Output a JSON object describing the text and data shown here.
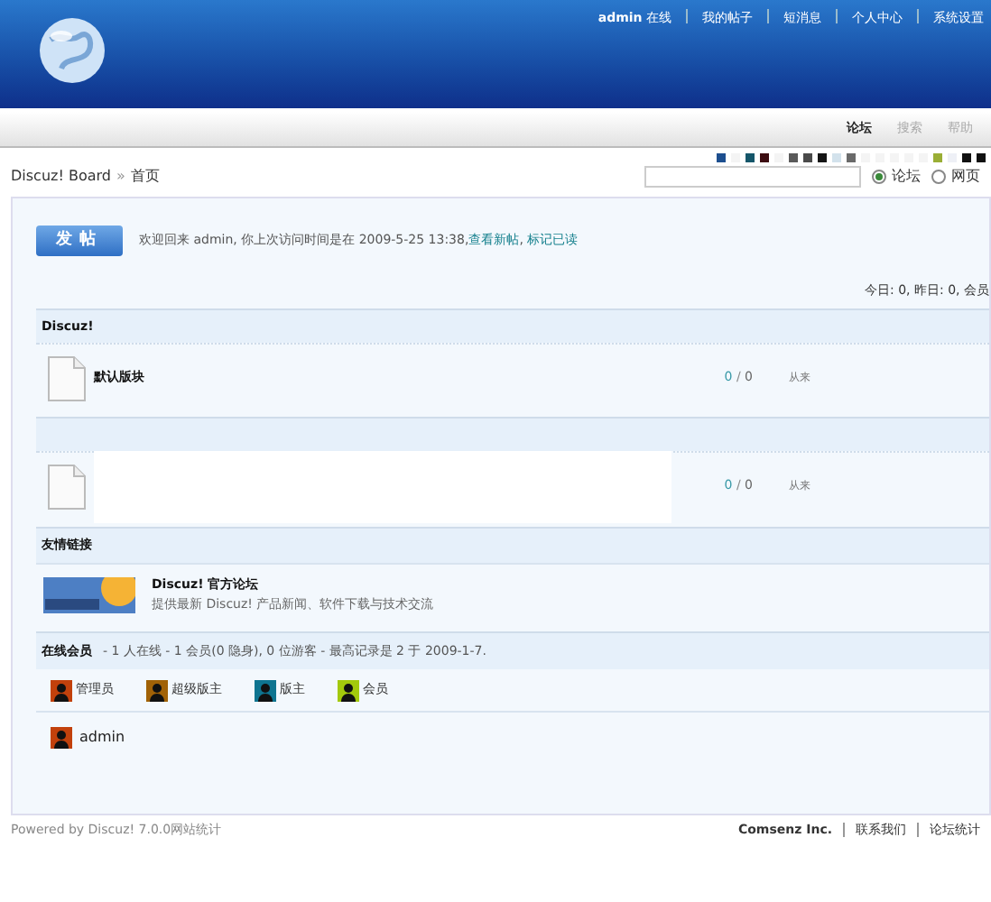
{
  "user_bar": {
    "user": "admin",
    "status": "在线",
    "links": [
      "我的帖子",
      "短消息",
      "个人中心",
      "系统设置"
    ]
  },
  "nav": [
    {
      "label": "论坛",
      "selected": true
    },
    {
      "label": "搜索",
      "selected": false
    },
    {
      "label": "帮助",
      "selected": false
    }
  ],
  "style_swatches": [
    {
      "color": "#1d4f8f"
    },
    {
      "color": "#f4f4f4"
    },
    {
      "color": "#15566a"
    },
    {
      "color": "#3d0d12"
    },
    {
      "color": "#f4f4f4"
    },
    {
      "color": "#5a5a5a"
    },
    {
      "color": "#4a4a4a"
    },
    {
      "color": "#151515"
    },
    {
      "color": "#d3e2ec"
    },
    {
      "color": "#6a6a6a"
    },
    {
      "color": "#f4f4f4"
    },
    {
      "color": "#f4f4f4"
    },
    {
      "color": "#f4f4f4"
    },
    {
      "color": "#f4f4f4"
    },
    {
      "color": "#f4f4f4"
    },
    {
      "color": "#9aae35"
    },
    {
      "color": "#eef0f6"
    },
    {
      "color": "#111111"
    },
    {
      "color": "#111111"
    }
  ],
  "breadcrumb": {
    "root": "Discuz! Board",
    "separator": "»",
    "current": "首页"
  },
  "search": {
    "scopes": [
      {
        "label": "论坛",
        "selected": true
      },
      {
        "label": "网页",
        "selected": false
      }
    ]
  },
  "post_button": "发帖",
  "welcome": {
    "text": "欢迎回来 admin, 你上次访问时间是在 2009-5-25 13:38,",
    "links": [
      "查看新帖",
      "标记已读"
    ],
    "link_separator": ","
  },
  "stats": "今日: 0, 昨日: 0, 会员",
  "categories": [
    {
      "title": "Discuz!",
      "forums": [
        {
          "name": "默认版块",
          "today": "0",
          "separator": "/",
          "total": "0",
          "last": "从来"
        }
      ]
    },
    {
      "forums": [
        {
          "today": "0",
          "separator": "/",
          "total": "0",
          "last": "从来"
        }
      ]
    }
  ],
  "friend_links": {
    "title": "友情链接",
    "items": [
      {
        "name": "Discuz! 官方论坛",
        "description": "提供最新 Discuz! 产品新闻、软件下载与技术交流"
      }
    ]
  },
  "online": {
    "title": "在线会员",
    "summary": "- 1 人在线 - 1 会员(0 隐身), 0 位游客 - 最高记录是 2 于 2009-1-7.",
    "groups": [
      {
        "label": "管理员",
        "color": "#c2410c"
      },
      {
        "label": "超级版主",
        "color": "#a16207"
      },
      {
        "label": "版主",
        "color": "#0e7490"
      },
      {
        "label": "会员",
        "color": "#a3c90c"
      }
    ],
    "members": [
      {
        "name": "admin",
        "color": "#c2410c"
      }
    ]
  },
  "footer": {
    "powered": "Powered by Discuz! 7.0.0网站统计",
    "company": "Comsenz Inc.",
    "links": [
      "联系我们",
      "论坛统计"
    ]
  }
}
